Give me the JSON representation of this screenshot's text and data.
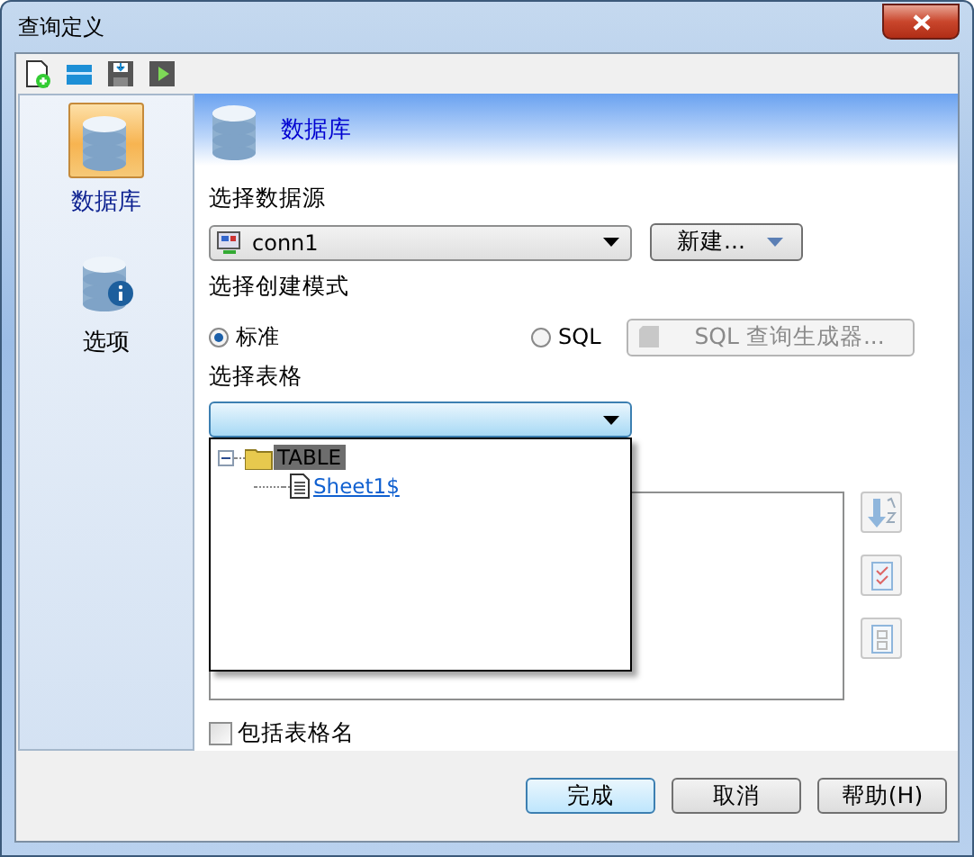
{
  "window": {
    "title": "查询定义"
  },
  "sidebar": {
    "items": [
      {
        "label": "数据库",
        "kind": "database",
        "selected": true
      },
      {
        "label": "选项",
        "kind": "options",
        "selected": false
      }
    ]
  },
  "header": {
    "title": "数据库"
  },
  "data_source": {
    "label": "选择数据源",
    "value": "conn1",
    "new_button": "新建..."
  },
  "mode": {
    "label": "选择创建模式",
    "options": [
      {
        "label": "标准",
        "selected": true
      },
      {
        "label": "SQL",
        "selected": false
      }
    ],
    "builder_button": {
      "label": "SQL 查询生成器...",
      "disabled": true
    }
  },
  "table": {
    "label": "选择表格",
    "expanded": true,
    "tree": [
      {
        "label": "TABLE",
        "expanded": true,
        "selected": true,
        "children": [
          {
            "label": "Sheet1$",
            "selected": false
          }
        ]
      }
    ]
  },
  "include_table_name": {
    "label": "包括表格名",
    "checked": false
  },
  "buttons": [
    {
      "label": "完成",
      "default": true
    },
    {
      "label": "取消",
      "default": false
    },
    {
      "label": "帮助(H)",
      "default": false
    }
  ]
}
